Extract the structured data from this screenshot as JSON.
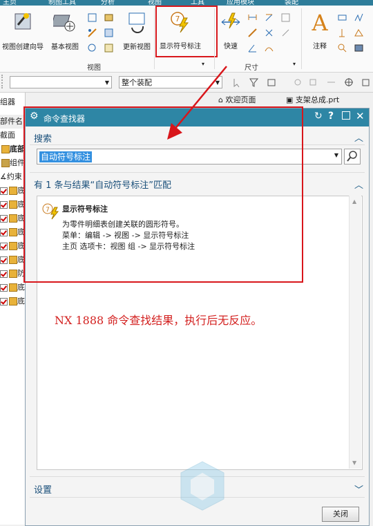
{
  "ribbon": {
    "tabs": [
      "主页",
      "制图工具",
      "分析",
      "视图",
      "工具",
      "应用模块",
      "装配"
    ],
    "buttons": {
      "view_wizard": "视图创建向导",
      "base_view": "基本视图",
      "update_views": "更新视图",
      "show_balloon": "显示符号标注",
      "rapid": "快速",
      "note": "注释"
    },
    "groups": {
      "view": "视图",
      "dimension": "尺寸"
    },
    "balloon_number": "7"
  },
  "toolbar": {
    "filter_value": "",
    "assembly_scope": "整个装配"
  },
  "nav": {
    "header": "组器",
    "col_part_name": "部件名",
    "rows": [
      "截面",
      "底部",
      "组件",
      "约束",
      "底",
      "底",
      "底",
      "底",
      "底",
      "底",
      "防",
      "底",
      "底"
    ]
  },
  "doc_tabs": [
    "欢迎页面",
    "支架总成.prt"
  ],
  "dialog": {
    "title": "命令查找器",
    "search_section": "搜索",
    "search_value": "自动符号标注",
    "results_header": "有 1 条与结果“自动符号标注”匹配",
    "result": {
      "title": "显示符号标注",
      "description": "为零件明细表创建关联的圆形符号。",
      "menu_path": "菜单：编辑 -> 视图 -> 显示符号标注",
      "tab_path": "主页 选项卡：视图 组 -> 显示符号标注"
    },
    "settings_section": "设置",
    "close_label": "关闭"
  },
  "annotation_note": "NX 1888 命令查找结果，执行后无反应。",
  "colors": {
    "title_bar": "#2e86a5",
    "highlight": "#d8161b",
    "selection": "#3390e0"
  }
}
